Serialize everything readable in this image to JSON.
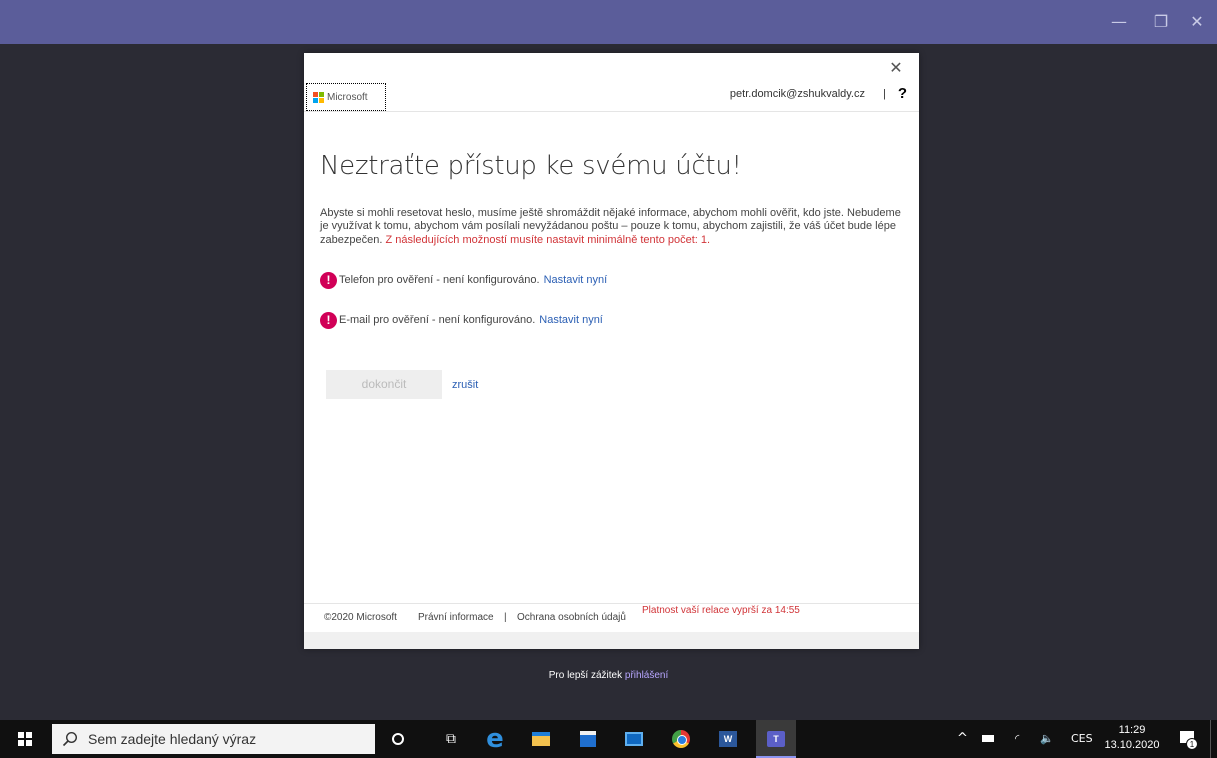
{
  "window": {
    "minimize_glyph": "—",
    "maximize_glyph": "❐",
    "close_glyph": "✕"
  },
  "dialog": {
    "close_glyph": "✕",
    "logo_text": "Microsoft",
    "user_email": "petr.domcik@zshukvaldy.cz",
    "separator": "|",
    "help_glyph": "?",
    "title": "Neztraťte přístup ke svému účtu!",
    "intro_text": "Abyste si mohli resetovat heslo, musíme ještě shromáždit nějaké informace, abychom mohli ověřit, kdo jste. Nebudeme je využívat k tomu, abychom vám posílali nevyžádanou poštu – pouze k tomu, abychom zajistili, že váš účet bude lépe zabezpečen. ",
    "intro_required": "Z následujících možností musíte nastavit minimálně tento počet: 1.",
    "methods": [
      {
        "icon": "warning-icon",
        "glyph": "!",
        "text": "Telefon pro ověření - není konfigurováno.",
        "link": "Nastavit nyní"
      },
      {
        "icon": "warning-icon",
        "glyph": "!",
        "text": "E-mail pro ověření - není konfigurováno.",
        "link": "Nastavit nyní"
      }
    ],
    "finish_label": "dokončit",
    "cancel_label": "zrušit",
    "footer": {
      "copyright": "©2020 Microsoft",
      "legal": "Právní informace",
      "separator": "|",
      "privacy": "Ochrana osobních údajů",
      "session": "Platnost vaší relace vyprší za 14:55"
    }
  },
  "below_dialog": {
    "text": "Pro lepší zážitek ",
    "link": "přihlášení"
  },
  "taskbar": {
    "search_placeholder": "Sem zadejte hledaný výraz",
    "apps": [
      "cortana-icon",
      "task-view-icon",
      "edge-icon",
      "file-explorer-icon",
      "store-icon",
      "mail-icon",
      "chrome-icon",
      "word-icon",
      "teams-icon"
    ],
    "tray": {
      "chevron": "^",
      "wifi_glyph": "◜",
      "volume_glyph": "🔈",
      "language": "CES",
      "time": "11:29",
      "date": "13.10.2020",
      "notification_count": "1"
    }
  },
  "colors": {
    "titlebar": "#5b5d9a",
    "background": "#2b2b34",
    "link": "#2b5fb4",
    "error": "#d13438",
    "warning_icon": "#d10057"
  }
}
